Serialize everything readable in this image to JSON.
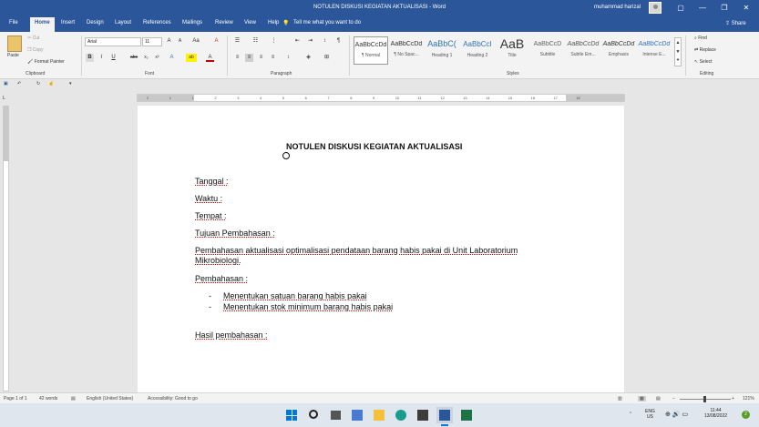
{
  "window": {
    "title": "NOTULEN DISKUSI KEGIATAN AKTUALISASI  -  Word",
    "user": "muhammad harizal",
    "controls": [
      "▢",
      "—",
      "❐",
      "✕"
    ]
  },
  "tabs": [
    "File",
    "Home",
    "Insert",
    "Design",
    "Layout",
    "References",
    "Mailings",
    "Review",
    "View",
    "Help"
  ],
  "tell_me": "Tell me what you want to do",
  "share": "Share",
  "clipboard": {
    "paste": "Paste",
    "cut": "Cut",
    "copy": "Copy",
    "format_painter": "Format Painter",
    "label": "Clipboard"
  },
  "font": {
    "name": "Arial",
    "size": "11",
    "label": "Font",
    "bold": "B",
    "italic": "I",
    "underline": "U",
    "strike": "abc",
    "subscript": "x₂",
    "superscript": "x²",
    "grow": "A",
    "shrink": "A",
    "case": "Aa",
    "clear": "A",
    "effects": "A",
    "highlight": "ab",
    "color": "A"
  },
  "paragraph": {
    "label": "Paragraph"
  },
  "styles": {
    "label": "Styles",
    "items": [
      {
        "preview": "AaBbCcDd",
        "name": "¶ Normal"
      },
      {
        "preview": "AaBbCcDd",
        "name": "¶ No Spac..."
      },
      {
        "preview": "AaBbC(",
        "name": "Heading 1"
      },
      {
        "preview": "AaBbCcI",
        "name": "Heading 2"
      },
      {
        "preview": "AaB",
        "name": "Title"
      },
      {
        "preview": "AaBbCcD",
        "name": "Subtitle"
      },
      {
        "preview": "AaBbCcDd",
        "name": "Subtle Em..."
      },
      {
        "preview": "AaBbCcDd",
        "name": "Emphasis"
      },
      {
        "preview": "AaBbCcDd",
        "name": "Intense E..."
      }
    ]
  },
  "editing": {
    "find": "Find",
    "replace": "Replace",
    "select": "Select",
    "label": "Editing"
  },
  "ruler": {
    "ticks": [
      "2",
      "1",
      "1",
      "2",
      "3",
      "4",
      "5",
      "6",
      "7",
      "8",
      "9",
      "10",
      "11",
      "12",
      "13",
      "14",
      "15",
      "16",
      "17",
      "18"
    ]
  },
  "document": {
    "title": "NOTULEN DISKUSI KEGIATAN AKTUALISASI",
    "lines": [
      "Tanggal :",
      "Waktu :",
      "Tempat :",
      "Tujuan Pembahasan :",
      "Pembahasan aktualisasi optimalisasi pendataan barang habis pakai di Unit Laboratorium",
      "Mikrobiologi.",
      "Pembahasan :",
      "Menentukan satuan barang habis pakai",
      "Menentukan stok minimum barang habis pakai",
      "Hasil pembahasan :"
    ],
    "dash": "-"
  },
  "status": {
    "page": "Page 1 of 1",
    "words": "42 words",
    "language": "English (United States)",
    "accessibility": "Accessibility: Good to go",
    "zoom": "121%"
  },
  "taskbar": {
    "lang1": "ENG",
    "lang2": "US",
    "time": "11:44",
    "date": "13/08/2022",
    "badge": "2"
  },
  "colors": {
    "word_blue": "#2b579a",
    "ribbon": "#f3f3f3",
    "page": "#ffffff"
  }
}
